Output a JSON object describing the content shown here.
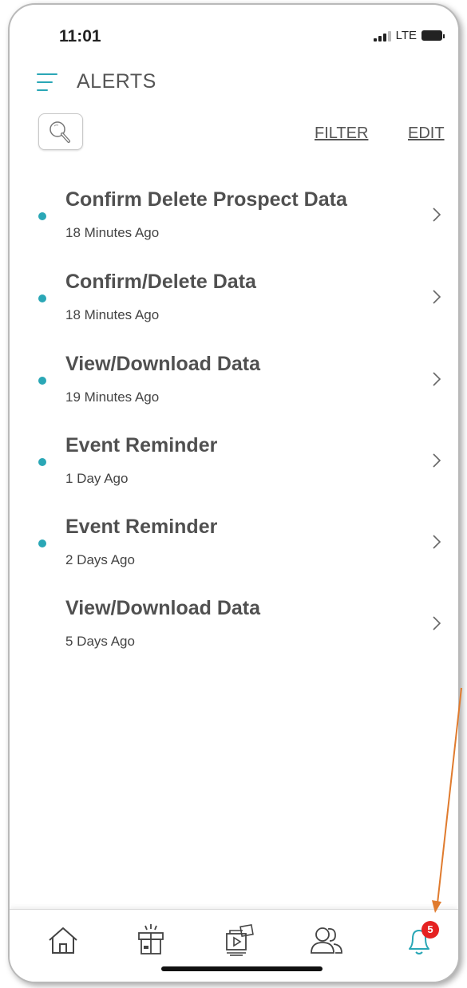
{
  "status_bar": {
    "time": "11:01",
    "network": "LTE"
  },
  "header": {
    "title": "ALERTS"
  },
  "toolbar": {
    "filter_label": "FILTER",
    "edit_label": "EDIT"
  },
  "alerts": [
    {
      "title": "Confirm Delete Prospect Data",
      "time": "18 Minutes Ago",
      "unread": true
    },
    {
      "title": "Confirm/Delete Data",
      "time": "18 Minutes Ago",
      "unread": true
    },
    {
      "title": "View/Download Data",
      "time": "19 Minutes Ago",
      "unread": true
    },
    {
      "title": "Event Reminder",
      "time": "1 Day Ago",
      "unread": true
    },
    {
      "title": "Event Reminder",
      "time": "2 Days Ago",
      "unread": true
    },
    {
      "title": "View/Download Data",
      "time": "5 Days Ago",
      "unread": false
    }
  ],
  "bottom_nav": {
    "items": [
      {
        "icon": "home-icon"
      },
      {
        "icon": "gift-icon"
      },
      {
        "icon": "media-icon"
      },
      {
        "icon": "people-icon"
      },
      {
        "icon": "bell-icon"
      }
    ],
    "alerts_badge": "5"
  },
  "colors": {
    "accent": "#2aa7b6",
    "badge": "#e52222",
    "annotation_arrow": "#e07b2e"
  }
}
